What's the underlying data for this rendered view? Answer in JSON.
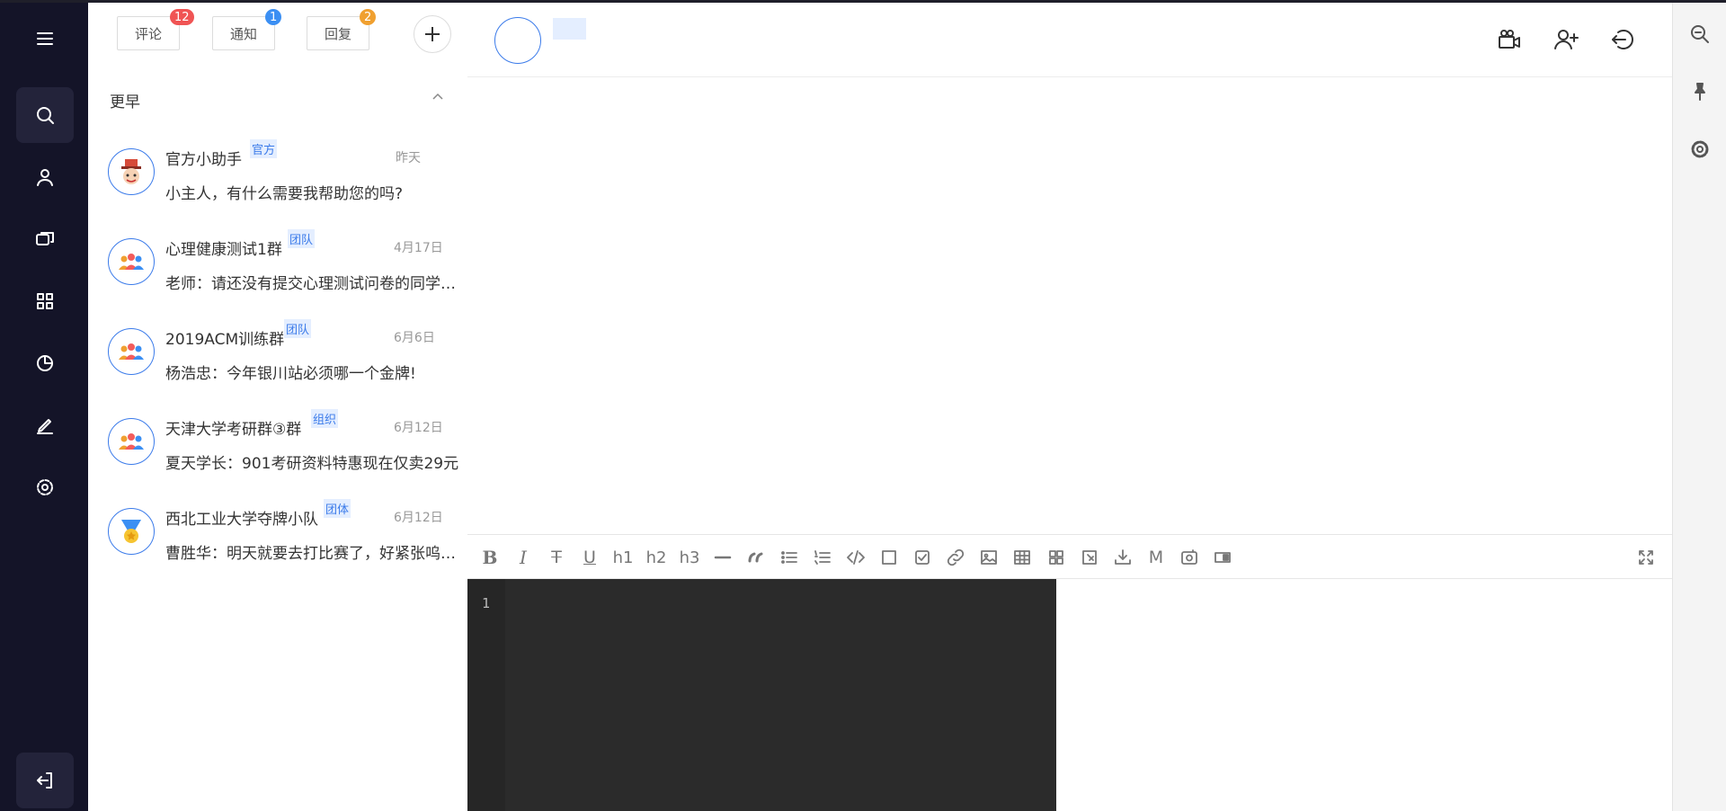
{
  "tabs": [
    {
      "label": "评论",
      "badge": "12",
      "badge_color": "#f05454"
    },
    {
      "label": "通知",
      "badge": "1",
      "badge_color": "#3b8ff3"
    },
    {
      "label": "回复",
      "badge": "2",
      "badge_color": "#f0a030"
    }
  ],
  "group": {
    "title": "更早"
  },
  "conversations": [
    {
      "name": "官方小助手",
      "tag": "官方",
      "date": "昨天",
      "message": "小主人，有什么需要我帮助您的吗?",
      "avatar": "mascot-icon"
    },
    {
      "name": "心理健康测试1群",
      "tag": "团队",
      "date": "4月17日",
      "message": "老师：请还没有提交心理测试问卷的同学尽快提交",
      "avatar": "group-icon"
    },
    {
      "name": "2019ACM训练群",
      "tag": "团队",
      "date": "6月6日",
      "message": "杨浩忠：今年银川站必须哪一个金牌!",
      "avatar": "group-icon"
    },
    {
      "name": "天津大学考研群③群",
      "tag": "组织",
      "date": "6月12日",
      "message": "夏天学长：901考研资料特惠现在仅卖29元",
      "avatar": "group-icon"
    },
    {
      "name": "西北工业大学夺牌小队",
      "tag": "团体",
      "date": "6月12日",
      "message": "曹胜华：明天就要去打比赛了，好紧张呜呜呜",
      "avatar": "medal-icon"
    }
  ],
  "editor": {
    "line_number": "1"
  },
  "colors": {
    "nav_bg": "#141428",
    "accent": "#3b7bea",
    "tag_bg": "#e4eeff",
    "editor_bg": "#2b2b2b"
  }
}
